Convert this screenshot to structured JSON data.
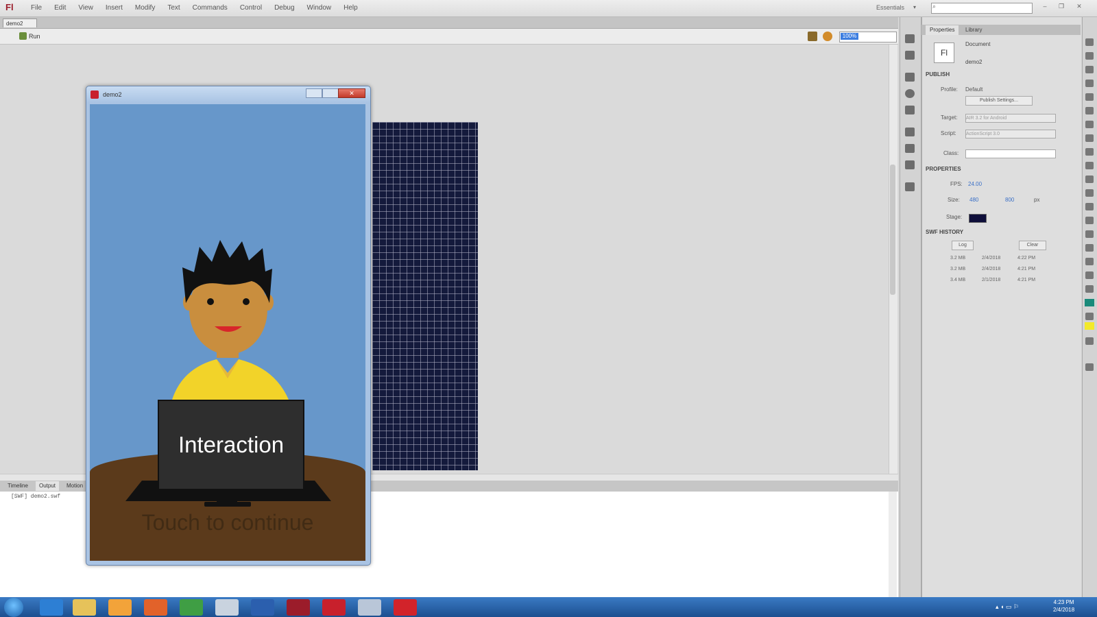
{
  "app": {
    "logo": "Fl",
    "menu": [
      "File",
      "Edit",
      "View",
      "Insert",
      "Modify",
      "Text",
      "Commands",
      "Control",
      "Debug",
      "Window",
      "Help"
    ],
    "workspace": "Essentials",
    "document_tab": "demo2",
    "scene": "Run",
    "zoom": "100%"
  },
  "preview_window": {
    "title": "demo2",
    "close": "✕",
    "monitor_text": "Interaction",
    "hint_text": "Touch to continue",
    "colors": {
      "sky": "#6797ca",
      "floor": "#5b3a1b",
      "skin": "#c98e3e",
      "shirt": "#f2d329",
      "hair": "#111111"
    }
  },
  "output": {
    "tabs": [
      "Timeline",
      "Output",
      "Motion"
    ],
    "line": "[SWF] demo2.swf"
  },
  "properties": {
    "tabs": [
      "Properties",
      "Library"
    ],
    "badge": "Fl",
    "doc_type": "Document",
    "doc_name": "demo2",
    "publish": {
      "header": "PUBLISH",
      "profile_label": "Profile:",
      "profile_value": "Default",
      "settings_button": "Publish Settings...",
      "target_label": "Target:",
      "target_value": "AIR 3.2 for Android",
      "script_label": "Script:",
      "script_value": "ActionScript 3.0",
      "class_label": "Class:"
    },
    "props": {
      "header": "PROPERTIES",
      "fps_label": "FPS:",
      "fps_value": "24.00",
      "size_label": "Size:",
      "width": "480",
      "height": "800",
      "unit": "px",
      "stage_label": "Stage:",
      "stage_color": "#0e0e3a"
    },
    "history": {
      "header": "SWF HISTORY",
      "log_button": "Log",
      "clear_button": "Clear",
      "rows": [
        [
          "3.2 MB",
          "2/4/2018",
          "4:22 PM"
        ],
        [
          "3.2 MB",
          "2/4/2018",
          "4:21 PM"
        ],
        [
          "3.4 MB",
          "2/1/2018",
          "4:21 PM"
        ]
      ]
    }
  },
  "taskbar": {
    "time": "4:23 PM",
    "date": "2/4/2018"
  }
}
